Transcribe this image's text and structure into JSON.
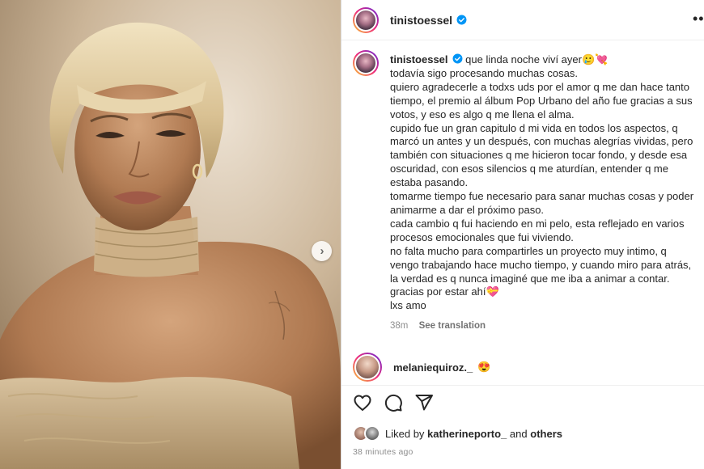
{
  "post": {
    "username": "tinistoessel",
    "caption_lines": [
      "que linda noche viví ayer🥲💘",
      "todavía sigo procesando muchas cosas.",
      "quiero agradecerle a todxs uds por el amor q me dan hace tanto",
      "tiempo, el premio al álbum Pop Urbano del año fue gracias a sus",
      "votos, y eso es algo q me llena el alma.",
      "cupido fue un gran capitulo d mi vida en todos los aspectos, q",
      "marcó un antes y un después, con muchas alegrías vividas, pero",
      "también con situaciones q me hicieron tocar fondo, y desde esa",
      "oscuridad, con esos silencios q me aturdían, entender q me",
      "estaba pasando.",
      "tomarme tiempo fue necesario para sanar muchas cosas y poder",
      "animarme a dar el próximo paso.",
      "cada cambio q fui haciendo en mi pelo, esta reflejado en varios",
      "procesos emocionales que fui viviendo.",
      "no falta mucho para compartirles un proyecto muy intimo, q",
      "vengo trabajando hace mucho tiempo, y cuando miro para atrás,",
      "la verdad es q nunca imaginé que me iba a animar a contar.",
      "gracias por estar ahí💝",
      "lxs amo"
    ],
    "caption_age": "38m",
    "see_translation": "See translation"
  },
  "comment": {
    "username": "melaniequiroz._",
    "text": "😍"
  },
  "likes": {
    "prefix": "Liked by",
    "user": "katherineporto_",
    "and": "and",
    "others": "others"
  },
  "timestamp": "38 minutes ago",
  "icons": {
    "verified": "verified-badge-icon",
    "more": "more-options-icon",
    "next": "next-image-icon",
    "like": "heart-icon",
    "comment": "comment-icon",
    "share": "share-icon"
  },
  "colors": {
    "verified_blue": "#0095f6",
    "story_ring_start": "#f9ce34",
    "story_ring_end": "#6228d7",
    "muted_text": "#8e8e8e"
  }
}
